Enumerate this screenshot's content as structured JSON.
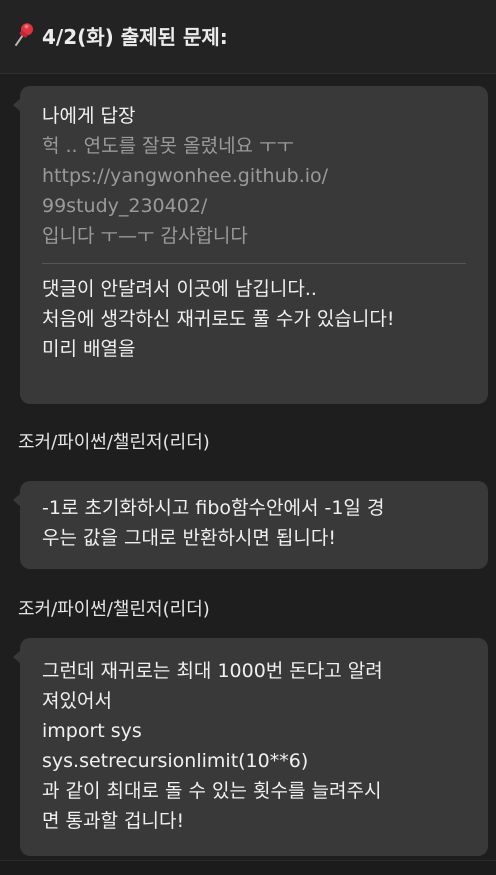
{
  "header": {
    "pin_icon": "pushpin-icon",
    "title": "4/2(화) 출제된 문제:"
  },
  "messages": [
    {
      "reply_label": "나에게 답장",
      "quoted_lines": [
        "헉 .. 연도를 잘못 올렸네요 ㅜㅜ",
        "https://yangwonhee.github.io/",
        "99study_230402/",
        "입니다 ㅜ—ㅜ 감사합니다"
      ],
      "body_lines": [
        "댓글이 안달려서 이곳에 남깁니다..",
        "처음에 생각하신 재귀로도 풀 수가 있습니다!",
        "미리 배열을"
      ]
    },
    {
      "sender": "조커/파이썬/챌린저(리더)",
      "body_lines": [
        "-1로 초기화하시고 fibo함수안에서 -1일 경",
        "우는 값을 그대로 반환하시면 됩니다!"
      ]
    },
    {
      "sender": "조커/파이썬/챌린저(리더)",
      "body_lines": [
        "그런데 재귀로는 최대 1000번 돈다고 알려",
        "져있어서",
        "import sys",
        "sys.setrecursionlimit(10**6)",
        "과 같이 최대로 돌 수 있는 횟수를 늘려주시",
        "면 통과할 겁니다!"
      ]
    }
  ]
}
